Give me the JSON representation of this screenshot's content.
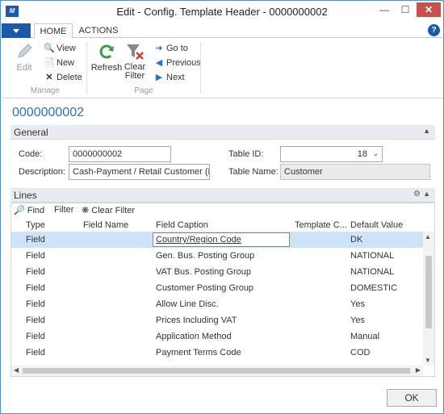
{
  "window": {
    "title": "Edit - Config. Template Header - 0000000002",
    "app_icon": "nav-logo-icon"
  },
  "tabs": [
    "HOME",
    "ACTIONS"
  ],
  "ribbon": {
    "manage": {
      "label": "Manage",
      "edit": "Edit",
      "view": "View",
      "new": "New",
      "delete": "Delete"
    },
    "page": {
      "label": "Page",
      "refresh": "Refresh",
      "clear_filter": "Clear Filter",
      "go_to": "Go to",
      "previous": "Previous",
      "next": "Next"
    }
  },
  "record_no": "0000000002",
  "general": {
    "title": "General",
    "code_label": "Code:",
    "code_value": "0000000002",
    "description_label": "Description:",
    "description_value": "Cash-Payment / Retail Customer (DK...",
    "table_id_label": "Table ID:",
    "table_id_value": "18",
    "table_name_label": "Table Name:",
    "table_name_value": "Customer"
  },
  "lines": {
    "title": "Lines",
    "toolbar": {
      "find": "Find",
      "filter": "Filter",
      "clear_filter": "Clear Filter"
    },
    "columns": [
      "Type",
      "Field Name",
      "Field Caption",
      "Template C...",
      "Default Value"
    ],
    "rows": [
      {
        "type": "Field",
        "field_name": "",
        "field_caption": "Country/Region Code",
        "template_code": "",
        "default_value": "DK"
      },
      {
        "type": "Field",
        "field_name": "",
        "field_caption": "Gen. Bus. Posting Group",
        "template_code": "",
        "default_value": "NATIONAL"
      },
      {
        "type": "Field",
        "field_name": "",
        "field_caption": "VAT Bus. Posting Group",
        "template_code": "",
        "default_value": "NATIONAL"
      },
      {
        "type": "Field",
        "field_name": "",
        "field_caption": "Customer Posting Group",
        "template_code": "",
        "default_value": "DOMESTIC"
      },
      {
        "type": "Field",
        "field_name": "",
        "field_caption": "Allow Line Disc.",
        "template_code": "",
        "default_value": "Yes"
      },
      {
        "type": "Field",
        "field_name": "",
        "field_caption": "Prices Including VAT",
        "template_code": "",
        "default_value": "Yes"
      },
      {
        "type": "Field",
        "field_name": "",
        "field_caption": "Application Method",
        "template_code": "",
        "default_value": "Manual"
      },
      {
        "type": "Field",
        "field_name": "",
        "field_caption": "Payment Terms Code",
        "template_code": "",
        "default_value": "COD"
      }
    ]
  },
  "footer": {
    "ok": "OK"
  },
  "colors": {
    "accent": "#1a5aa8",
    "link": "#2e73c6",
    "close": "#c7504c",
    "selected_row": "#cde3f7"
  }
}
